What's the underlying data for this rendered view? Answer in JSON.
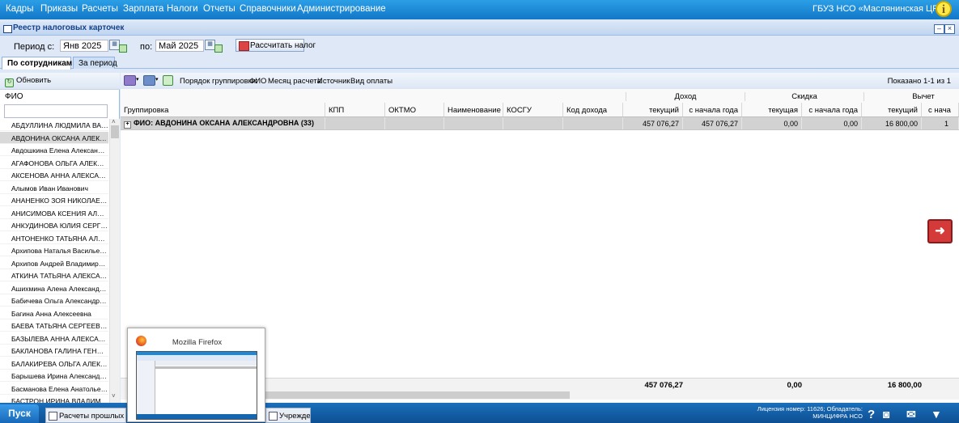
{
  "menu": {
    "items": [
      "Кадры",
      "Приказы",
      "Расчеты",
      "Зарплата",
      "Налоги",
      "Отчеты",
      "Справочники",
      "Администрирование"
    ],
    "org": "ГБУЗ НСО «Маслянинская ЦРБ»"
  },
  "window": {
    "title": "Реестр налоговых карточек"
  },
  "filter": {
    "period_from_label": "Период с:",
    "period_from_value": "Янв 2025",
    "period_to_label": "по:",
    "period_to_value": "Май 2025",
    "calc_button": "Рассчитать налог"
  },
  "tabs": [
    "По сотрудникам",
    "За период"
  ],
  "left": {
    "refresh": "Обновить",
    "header": "ФИО",
    "employees": [
      "АБДУЛЛИНА ЛЮДМИЛА ВАЛЕ...",
      "АВДОНИНА ОКСАНА АЛЕКСА...",
      "Авдошкина Елена Александр...",
      "АГАФОНОВА ОЛЬГА АЛЕКСЕ...",
      "АКСЕНОВА АННА АЛЕКСАНД...",
      "Алымов Иван Иванович",
      "АНАНЕНКО ЗОЯ НИКОЛАЕВНА",
      "АНИСИМОВА КСЕНИЯ АЛЕКС...",
      "АНКУДИНОВА ЮЛИЯ СЕРГЕЕ...",
      "АНТОНЕНКО ТАТЬЯНА АЛЕКС...",
      "Архипова Наталья Васильевна",
      "Архипов Андрей Владимиров...",
      "АТКИНА ТАТЬЯНА АЛЕКСАНД...",
      "Ашихмина Алена Александро...",
      "Бабичева Ольга Александров...",
      "Багина Анна Алексеевна",
      "БАЕВА ТАТЬЯНА СЕРГЕЕВНА",
      "БАЗЫЛЕВА АННА АЛЕКСАНДР...",
      "БАКЛАНОВА ГАЛИНА ГЕННА...",
      "БАЛАКИРЕВА ОЛЬГА АЛЕКСЕ...",
      "Барышева Ирина Александр...",
      "Басманова Елена Анатольевна",
      "БАСТРОН ИРИНА ВЛАДИМИР..."
    ],
    "selected_index": 1
  },
  "right": {
    "grouping_label": "Порядок группировки:",
    "grouping_items": [
      "ФИО",
      "Месяц расчета",
      "Источник",
      "Вид оплаты"
    ],
    "shown": "Показано 1-1 из 1",
    "group_headers": [
      "Доход",
      "Скидка",
      "Вычет"
    ],
    "columns": [
      "Группировка",
      "КПП",
      "ОКТМО",
      "Наименование ...",
      "КОСГУ",
      "Код дохода",
      "текущий",
      "с начала года",
      "текущая",
      "с начала года",
      "текущий",
      "с нача"
    ],
    "group_row": {
      "label": "ФИО: АВДОНИНА ОКСАНА АЛЕКСАНДРОВНА (33)",
      "values": [
        "457 076,27",
        "457 076,27",
        "0,00",
        "0,00",
        "16 800,00",
        "1"
      ]
    },
    "totals": [
      "457 076,27",
      "0,00",
      "16 800,00"
    ]
  },
  "taskbar": {
    "start": "Пуск",
    "tasks": [
      "Расчеты прошлых пер",
      "Учреждения"
    ],
    "license": "Лицензия номер: 11626; Обладатель: МИНЦИФРА НСО"
  },
  "preview": {
    "title": "Mozilla Firefox"
  }
}
